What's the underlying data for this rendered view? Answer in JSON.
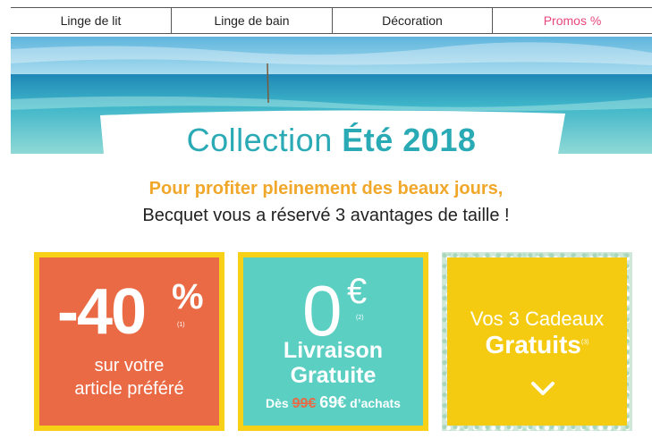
{
  "nav": {
    "items": [
      {
        "label": "Linge de lit"
      },
      {
        "label": "Linge de bain"
      },
      {
        "label": "Décoration"
      },
      {
        "label": "Promos %",
        "color": "#e8467c"
      }
    ]
  },
  "hero": {
    "title_regular": "Collection",
    "title_bold": "Été 2018"
  },
  "intro": {
    "line1": "Pour profiter pleinement des beaux jours,",
    "line2": "Becquet vous a réservé 3 avantages de taille !"
  },
  "offers": {
    "discount": {
      "value": "-40",
      "sign": "%",
      "note": "(1)",
      "line1": "sur votre",
      "line2": "article préféré"
    },
    "shipping": {
      "value": "0",
      "sign": "€",
      "note": "(2)",
      "line1": "Livraison",
      "line2": "Gratuite",
      "prefix": "Dès",
      "old_price": "99€",
      "new_price": "69€",
      "suffix": "d’achats"
    },
    "gifts": {
      "line1": "Vos 3 Cadeaux",
      "line2": "Gratuits",
      "note": "(3)",
      "chevron_icon": "chevron-down-icon"
    }
  },
  "colors": {
    "accent_teal": "#2aaab5",
    "accent_orange": "#f0a72a",
    "card_orange": "#e96a45",
    "card_teal": "#5ccfc3",
    "card_yellow": "#f5cb12",
    "frame_yellow": "#f6d117",
    "promo_pink": "#e8467c"
  }
}
